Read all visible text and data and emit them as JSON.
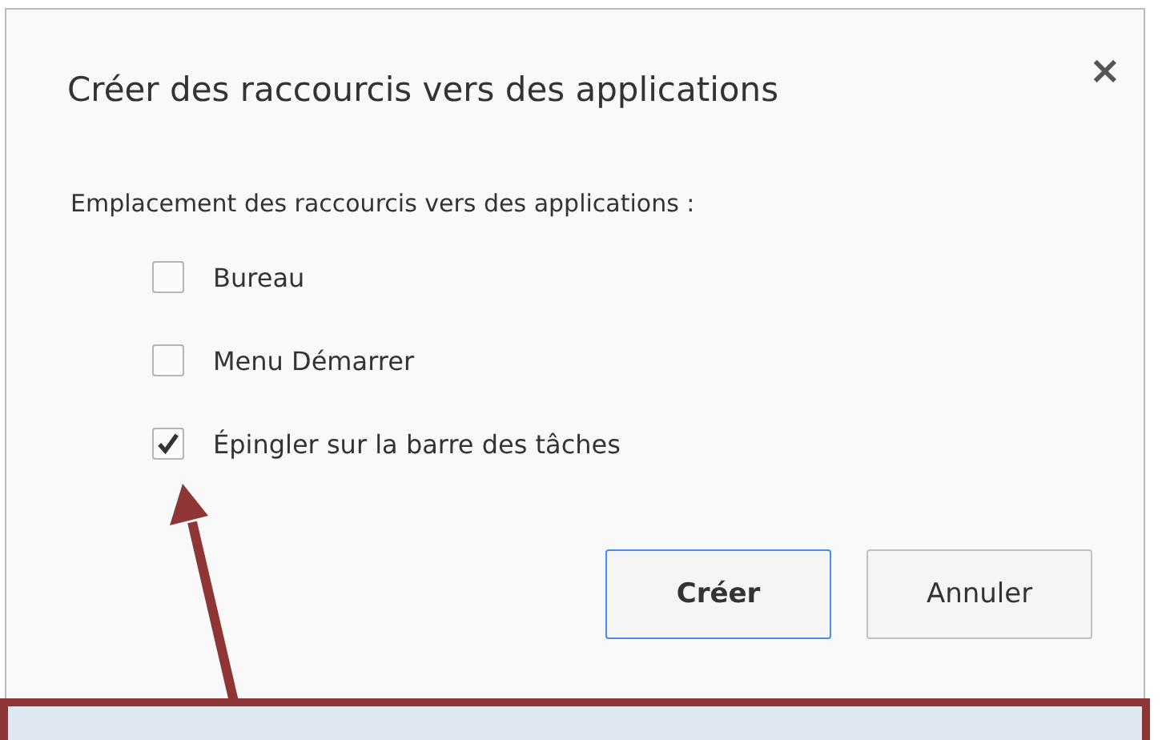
{
  "dialog": {
    "title": "Créer des raccourcis vers des applications",
    "close": "×",
    "prompt": "Emplacement des raccourcis vers des applications :",
    "options": [
      {
        "label": "Bureau",
        "checked": false
      },
      {
        "label": "Menu Démarrer",
        "checked": false
      },
      {
        "label": "Épingler sur la barre des tâches",
        "checked": true
      }
    ],
    "buttons": [
      {
        "label": "Créer",
        "kind": "primary"
      },
      {
        "label": "Annuler",
        "kind": "secondary"
      }
    ]
  }
}
